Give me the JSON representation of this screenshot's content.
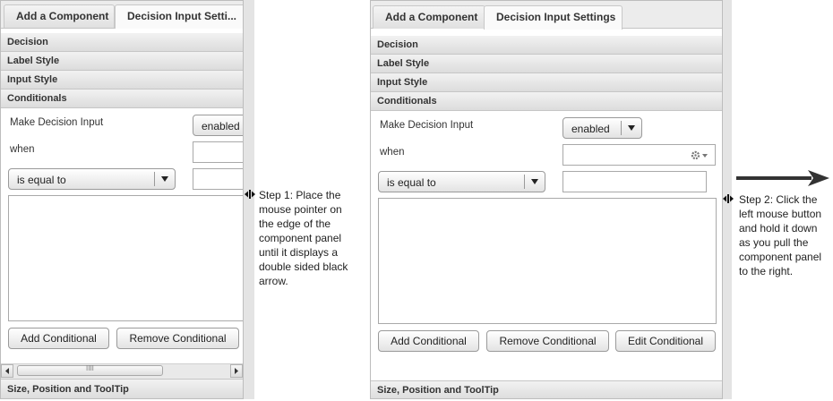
{
  "left_panel": {
    "tabs": [
      "Add a Component",
      "Decision Input Setti..."
    ],
    "sections": [
      "Decision",
      "Label Style",
      "Input Style",
      "Conditionals"
    ],
    "make_decision_label": "Make Decision Input",
    "enabled_value": "enabled",
    "when_label": "when",
    "operator_value": "is equal to",
    "add_conditional": "Add Conditional",
    "remove_conditional": "Remove Conditional",
    "scroll_grip": "IIII",
    "footer_section": "Size, Position and ToolTip"
  },
  "right_panel": {
    "tabs": [
      "Add a Component",
      "Decision Input Settings"
    ],
    "sections": [
      "Decision",
      "Label Style",
      "Input Style",
      "Conditionals"
    ],
    "make_decision_label": "Make Decision Input",
    "enabled_value": "enabled",
    "when_label": "when",
    "operator_value": "is equal to",
    "add_conditional": "Add Conditional",
    "remove_conditional": "Remove Conditional",
    "edit_conditional": "Edit Conditional",
    "footer_section": "Size, Position and ToolTip"
  },
  "steps": {
    "step1": [
      "Step 1: Place the",
      "mouse pointer on",
      "the edge of the",
      "component panel",
      "until it displays a",
      "double sided black",
      "arrow."
    ],
    "step2": [
      "Step 2: Click the",
      "left mouse button",
      "and hold it down",
      "as you pull the",
      "component panel",
      "to the right."
    ]
  },
  "icons": {
    "resize_cursor": "resize-horizontal-cursor-icon",
    "gear": "gear-icon",
    "arrow": "right-arrow-icon"
  },
  "colors": {
    "section_bg": "#e2e2e2",
    "border": "#bdbdbd",
    "gutter": "#e4e4e4"
  }
}
